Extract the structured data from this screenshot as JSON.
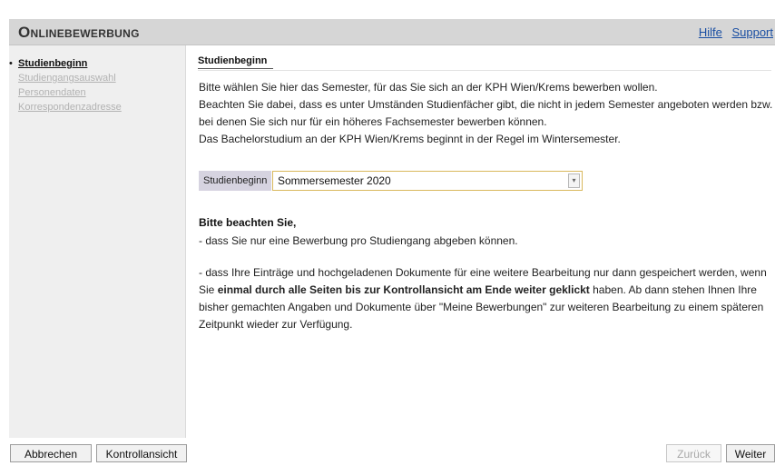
{
  "header": {
    "title": "Onlinebewerbung",
    "links": [
      "Hilfe",
      "Support"
    ]
  },
  "sidebar": {
    "items": [
      {
        "label": "Studienbeginn",
        "active": true
      },
      {
        "label": "Studiengangsauswahl",
        "active": false
      },
      {
        "label": "Personendaten",
        "active": false
      },
      {
        "label": "Korrespondenzadresse",
        "active": false
      }
    ]
  },
  "main": {
    "section_title": "Studienbeginn",
    "intro": [
      "Bitte wählen Sie hier das Semester, für das Sie sich an der KPH Wien/Krems bewerben wollen.",
      "Beachten Sie dabei, dass es unter Umständen Studienfächer gibt, die nicht in jedem Semester angeboten werden bzw. bei denen Sie sich nur für ein höheres Fachsemester bewerben können.",
      "Das Bachelorstudium an der KPH Wien/Krems beginnt in der Regel im Wintersemester."
    ],
    "field": {
      "label": "Studienbeginn",
      "value": "Sommersemester 2020"
    },
    "notice": {
      "title": "Bitte beachten Sie,",
      "line1": "- dass Sie nur eine Bewerbung pro Studiengang abgeben können.",
      "line2_start": "- dass Ihre Einträge und hochgeladenen Dokumente für eine weitere Bearbeitung nur dann gespeichert werden, wenn Sie ",
      "line2_bold": "einmal durch alle Seiten bis zur Kontrollansicht am Ende weiter geklickt",
      "line2_end": " haben. Ab dann stehen Ihnen Ihre bisher gemachten Angaben und Dokumente über \"Meine Bewerbungen\" zur weiteren Bearbeitung zu einem späteren Zeitpunkt wieder zur Verfügung."
    }
  },
  "footer": {
    "cancel": "Abbrechen",
    "review": "Kontrollansicht",
    "back": "Zurück",
    "next": "Weiter"
  },
  "colors": {
    "header_bg": "#d6d6d6",
    "sidebar_bg": "#efefef",
    "link": "#1a4fa3",
    "field_label_bg": "#d6d3e0",
    "select_border": "#d9b85c"
  }
}
